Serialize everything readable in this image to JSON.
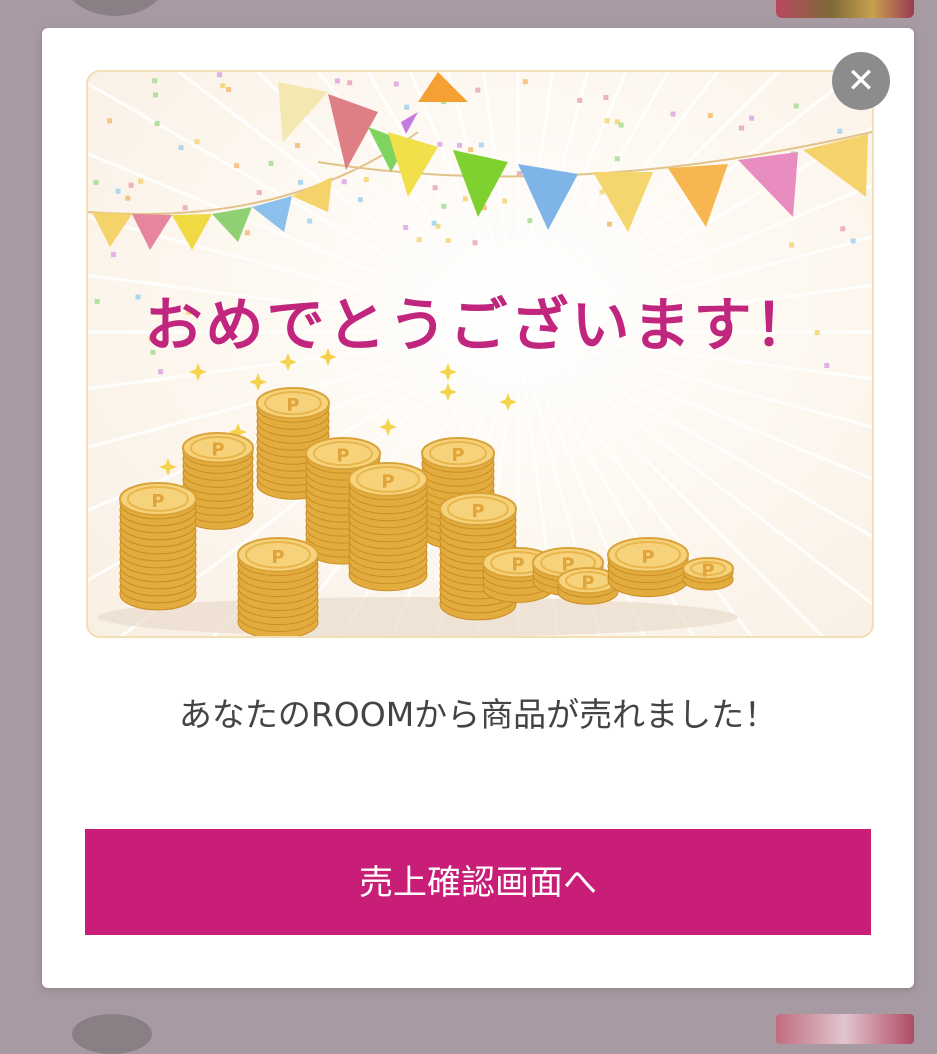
{
  "dialog": {
    "headline": "おめでとうございます！",
    "message": "あなたのROOMから商品が売れました！",
    "button_label": "売上確認画面へ",
    "close_icon": "close-icon",
    "coin_label": "P"
  },
  "colors": {
    "overlay": "#a89aa3",
    "accent": "#c81e78",
    "headline": "#c0267e",
    "close_bg": "#8c8c8c"
  }
}
